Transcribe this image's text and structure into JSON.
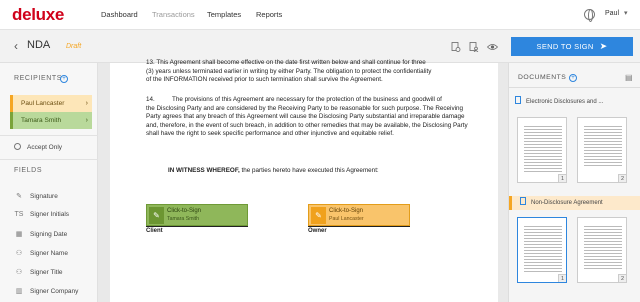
{
  "app": {
    "logo_text": "deluxe",
    "nav": [
      "Dashboard",
      "Transactions",
      "Templates",
      "Reports"
    ],
    "user_name": "Paul"
  },
  "document": {
    "title": "NDA",
    "status": "Draft",
    "send_button": "SEND TO SIGN",
    "toolbar_icons": [
      "settings-doc-icon",
      "recipients-doc-icon",
      "preview-eye-icon"
    ]
  },
  "sidebar": {
    "recipients_title": "RECIPIENTS",
    "recipients": [
      {
        "name": "Paul Lancaster",
        "color": "#f5a623"
      },
      {
        "name": "Tamara Smith",
        "color": "#7aa33a"
      }
    ],
    "accept_only": "Accept Only",
    "fields_title": "FIELDS",
    "fields": [
      {
        "label": "Signature",
        "icon": "pen-icon"
      },
      {
        "label": "Signer Initials",
        "icon": "initials-icon"
      },
      {
        "label": "Signing Date",
        "icon": "calendar-icon"
      },
      {
        "label": "Signer Name",
        "icon": "person-icon"
      },
      {
        "label": "Signer Title",
        "icon": "person-title-icon"
      },
      {
        "label": "Signer Company",
        "icon": "company-icon"
      }
    ]
  },
  "page": {
    "para13_cut": "13.        This Agreement shall become effective on the date first written below and shall continue for three",
    "para13_line2": "(3) years unless terminated earlier in writing by either Party. The obligation to protect the confidentiality",
    "para13_line3": "of the INFORMATION received prior to such termination shall survive the Agreement.",
    "para14_num": "14.",
    "para14_text": "The provisions of this Agreement are necessary for the protection of the business and goodwill of",
    "para14_rest": "the Disclosing Party and are considered by the Receiving Party to be reasonable for such purpose. The Receiving Party agrees that any breach of this Agreement will cause the Disclosing Party substantial and irreparable damage and, therefore, in the event of such breach, in addition to other remedies that may be available, the Disclosing Party shall have the right to seek specific performance and other injunctive and equitable relief.",
    "witness_bold": "IN WITNESS WHEREOF,",
    "witness_rest": " the parties hereto have executed this Agreement:",
    "sig_client": {
      "title": "Click-to-Sign",
      "signer": "Tamara Smith",
      "label": "Client"
    },
    "sig_owner": {
      "title": "Click-to-Sign",
      "signer": "Paul Lancaster",
      "label": "Owner"
    }
  },
  "documents_panel": {
    "title": "DOCUMENTS",
    "docs": [
      {
        "name": "Electronic Disclosures and ...",
        "pages": [
          "1",
          "2"
        ]
      },
      {
        "name": "Non-Disclosure Agreement",
        "pages": [
          "1",
          "2"
        ]
      }
    ]
  }
}
